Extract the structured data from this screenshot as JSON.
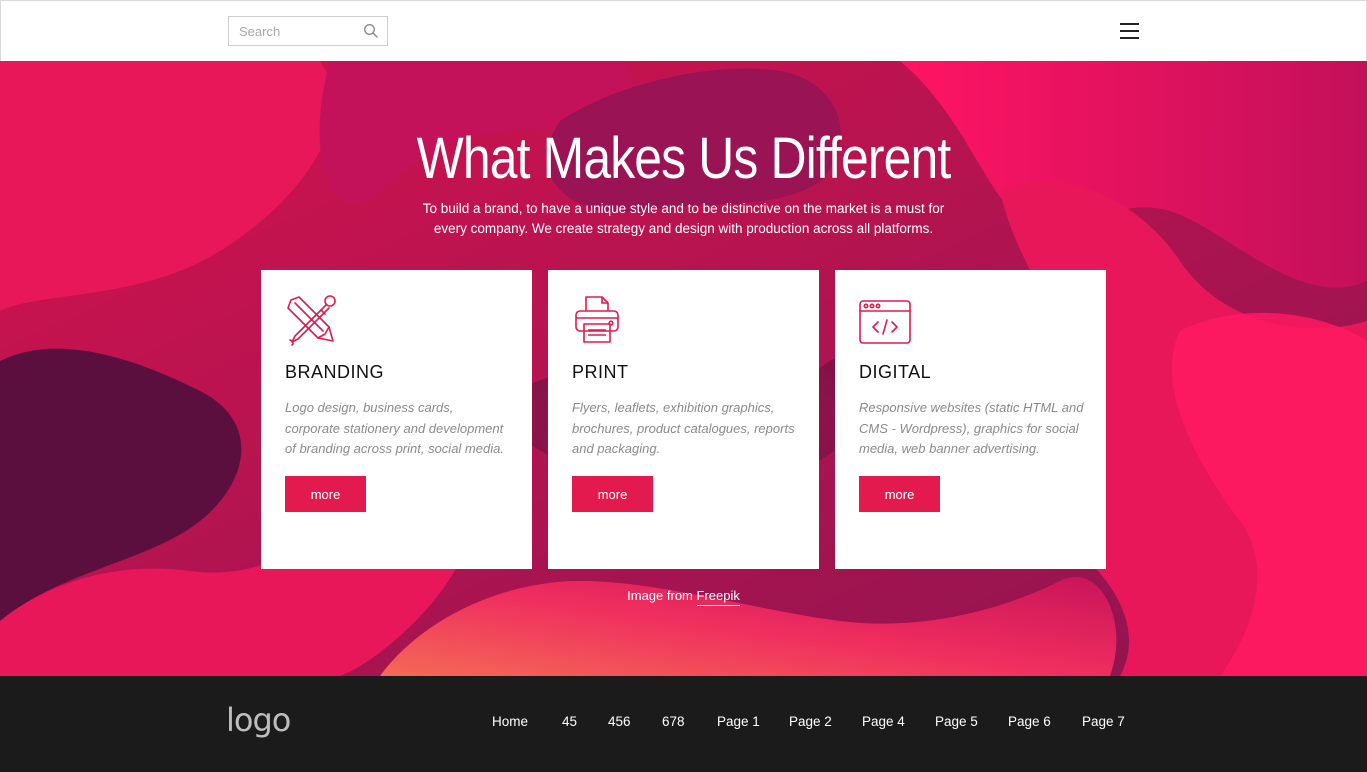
{
  "header": {
    "search_placeholder": "Search",
    "icons": {
      "search": "search-icon",
      "menu": "hamburger-menu-icon"
    }
  },
  "hero": {
    "title": "What Makes Us Different",
    "subtitle_line1": "To build a brand, to have a unique style and to be distinctive on the market is a must for",
    "subtitle_line2": "every company.  We create strategy and design with production across all platforms.",
    "credit_prefix": "Image from ",
    "credit_link": "Freepik"
  },
  "cards": [
    {
      "title": "BRANDING",
      "icon": "pencil-brush-icon",
      "text": "Logo design, business cards, corporate stationery and development of branding across print, social media.",
      "button": "more"
    },
    {
      "title": "PRINT",
      "icon": "printer-icon",
      "text": "Flyers, leaflets, exhibition graphics, brochures, product catalogues, reports and packaging.",
      "button": "more"
    },
    {
      "title": "DIGITAL",
      "icon": "browser-code-icon",
      "text": "Responsive websites (static HTML and CMS - Wordpress), graphics for social media, web banner advertising.",
      "button": "more"
    }
  ],
  "footer": {
    "logo": "logo",
    "nav": [
      "Home",
      "45",
      "456",
      "678",
      "Page 1",
      "Page 2",
      "Page 4",
      "Page 5",
      "Page 6",
      "Page 7"
    ]
  },
  "colors": {
    "accent": "#e21a4d",
    "hero_pink": "#e8175a",
    "hero_purple": "#6e1247",
    "footer_bg": "#1b1b1b"
  }
}
